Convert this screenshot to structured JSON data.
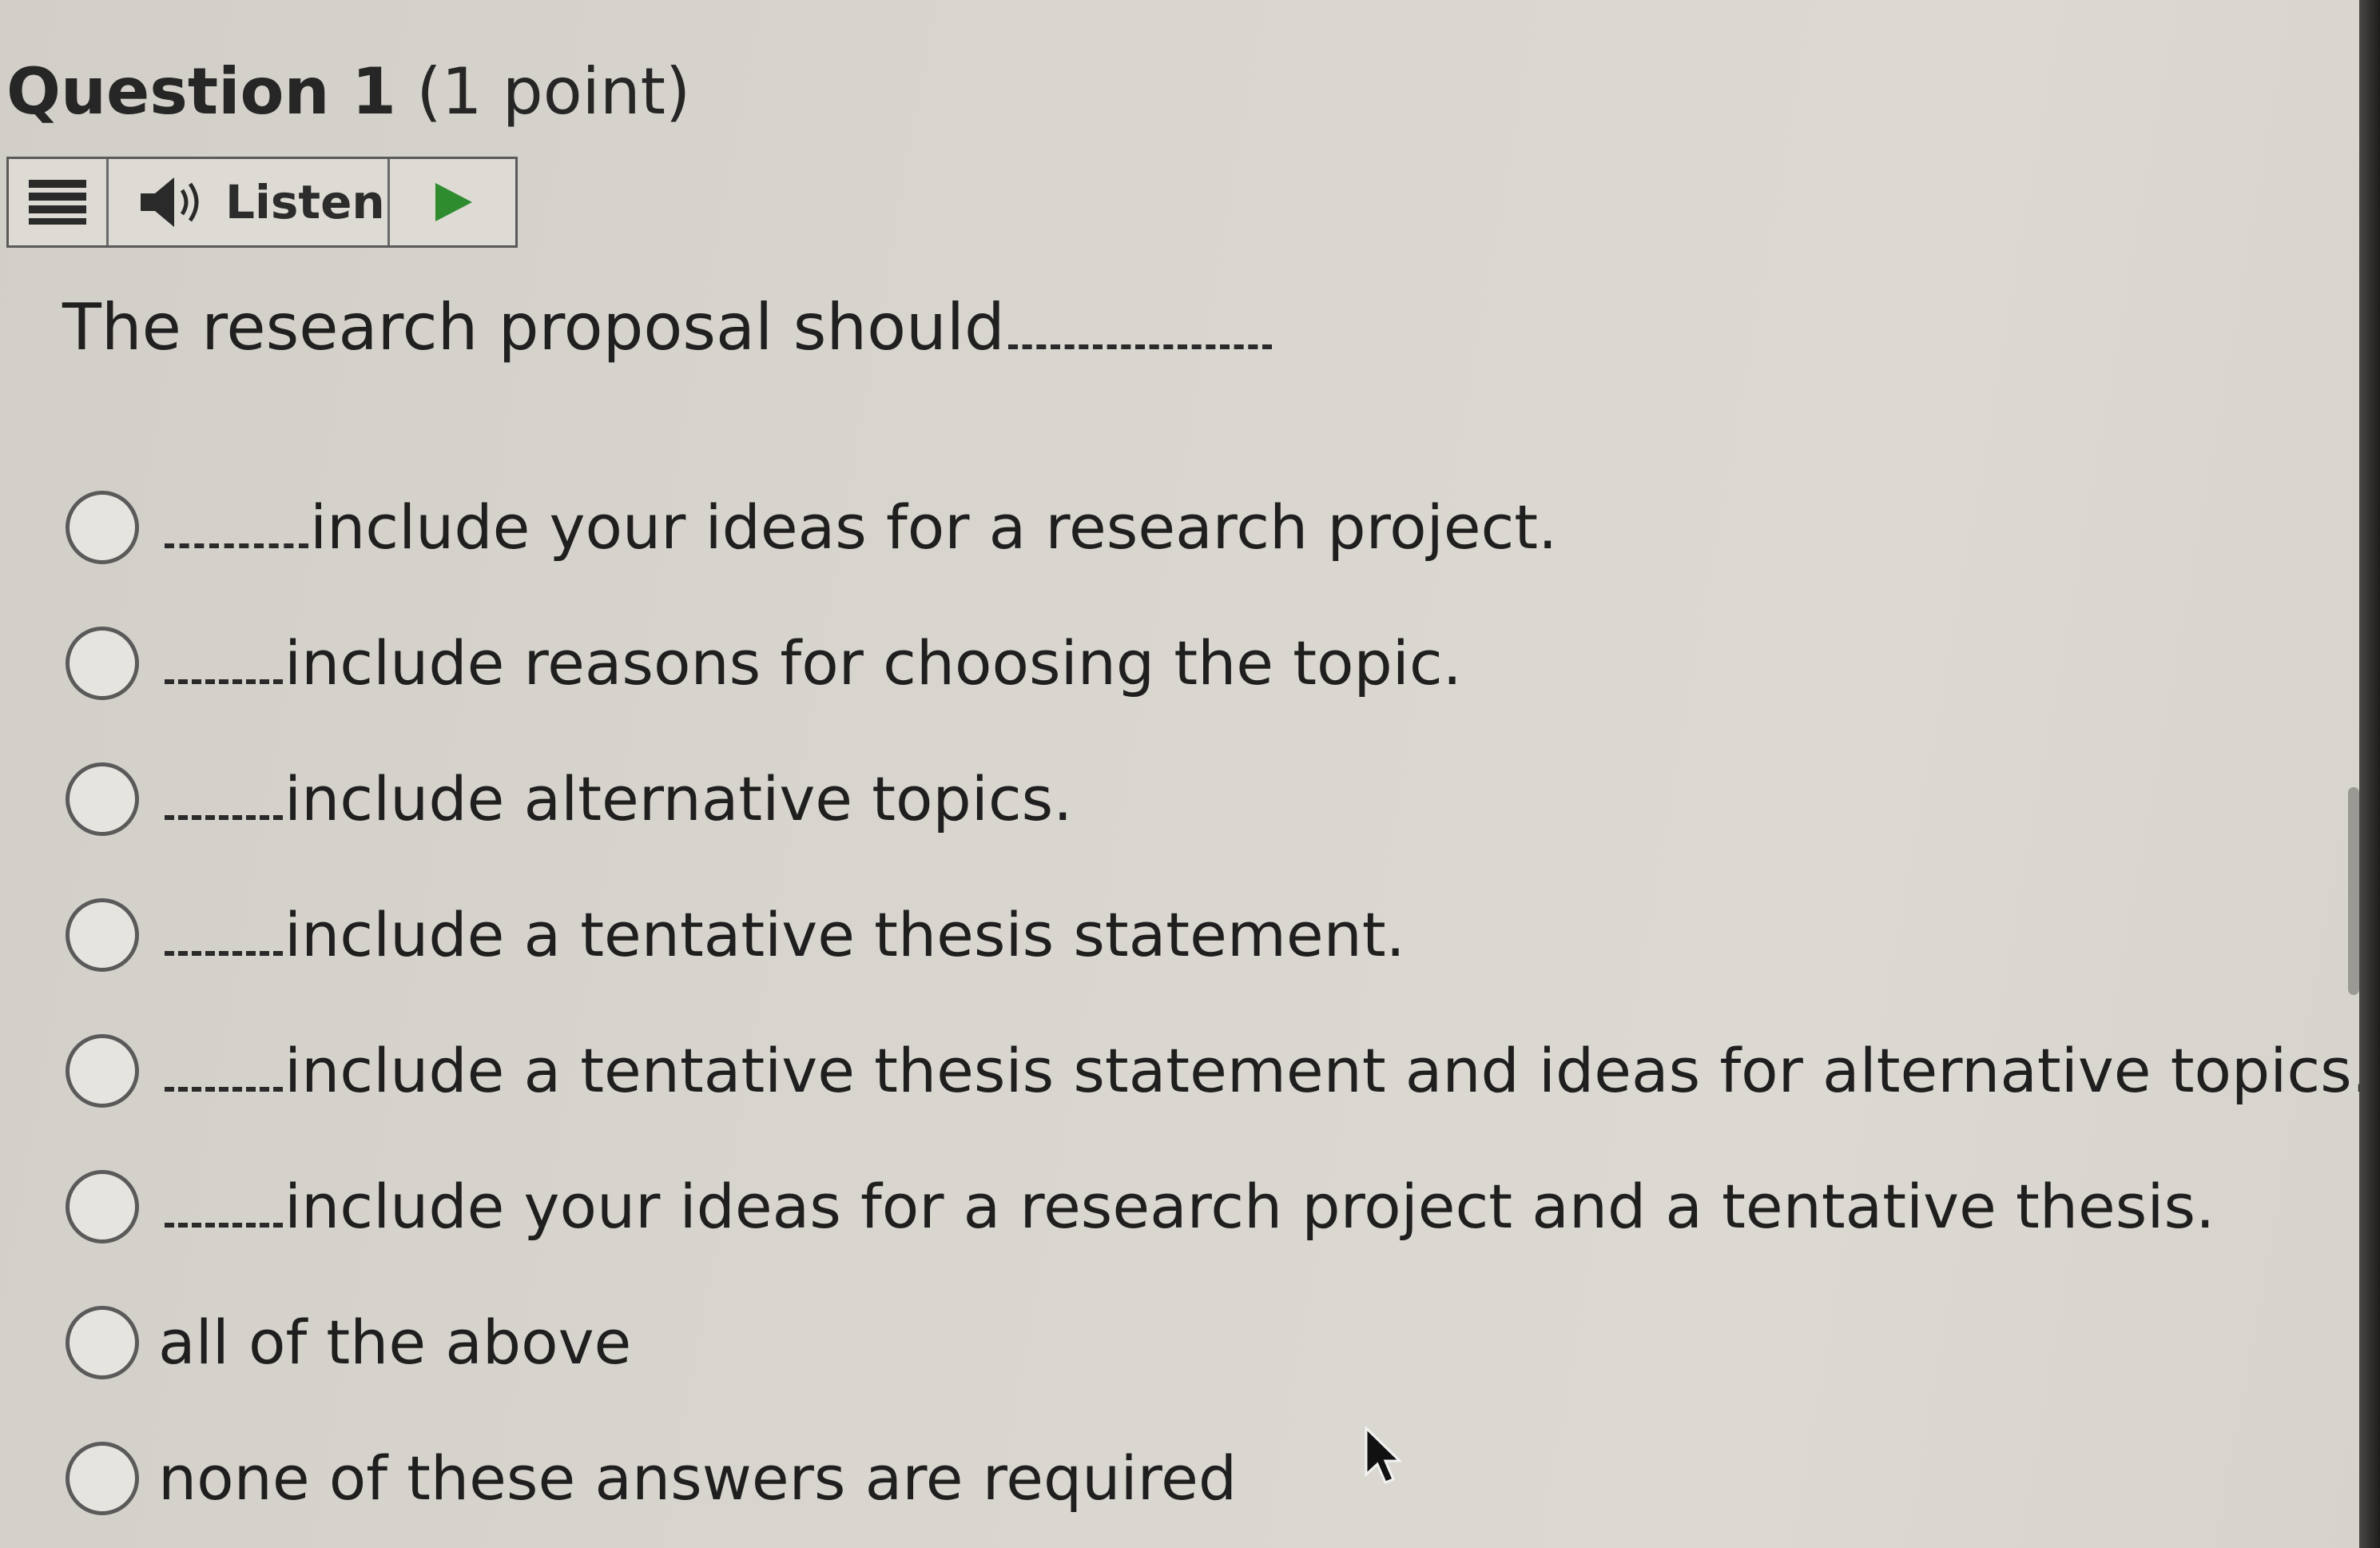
{
  "question": {
    "number_label": "Question 1",
    "points_label": "(1 point)"
  },
  "toolbar": {
    "menu_icon": "hamburger-menu-icon",
    "speaker_icon": "speaker-icon",
    "listen_label": "Listen",
    "play_icon": "play-icon",
    "play_color": "#2e8b2e"
  },
  "prompt": {
    "text": "The research proposal should"
  },
  "options": [
    {
      "text": "include your ideas for a research project.",
      "lead_blank": true
    },
    {
      "text": "include reasons for choosing the topic.",
      "lead_blank": true
    },
    {
      "text": "include alternative topics.",
      "lead_blank": true
    },
    {
      "text": "include a tentative thesis statement.",
      "lead_blank": true
    },
    {
      "text": "include a tentative thesis statement and ideas for alternative topics.",
      "lead_blank": true
    },
    {
      "text": "include your ideas for a research project and a tentative thesis.",
      "lead_blank": true
    },
    {
      "text": "all of the above",
      "lead_blank": false
    },
    {
      "text": "none of these answers are required",
      "lead_blank": false
    }
  ]
}
